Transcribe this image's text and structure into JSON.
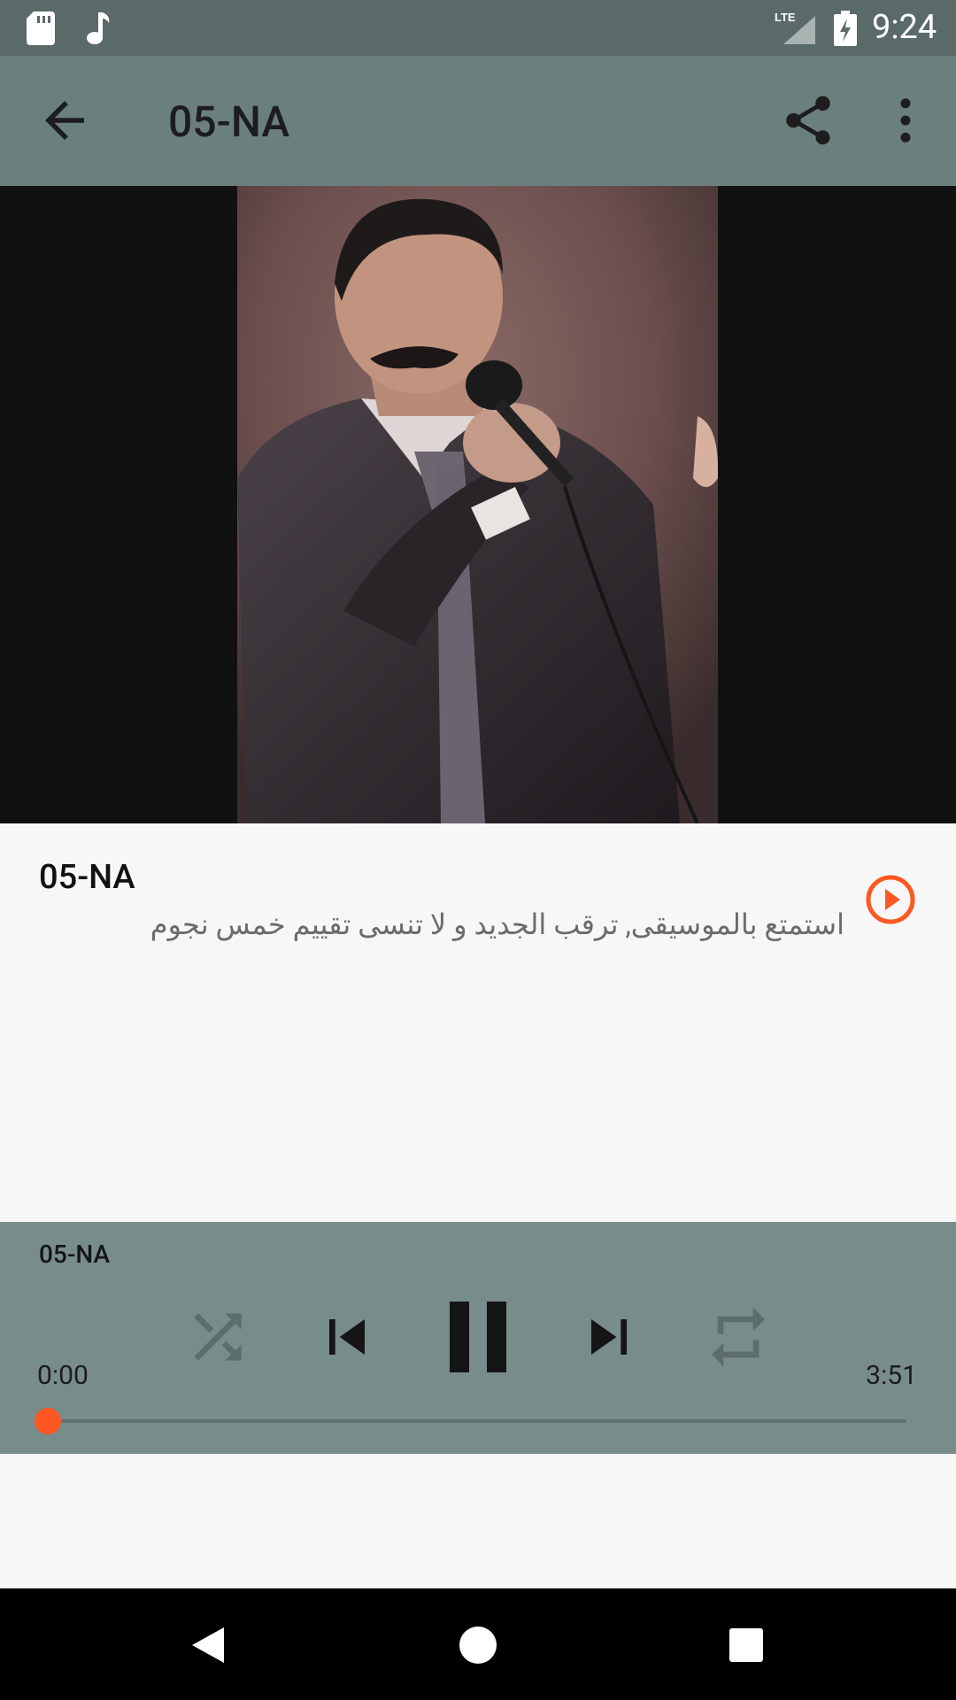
{
  "status_bar": {
    "time": "9:24",
    "network": "LTE",
    "icons": [
      "sd-card-icon",
      "music-note-icon",
      "lte-signal-icon",
      "battery-charging-icon"
    ]
  },
  "app_bar": {
    "title": "05-NA",
    "icons": [
      "arrow-back-icon",
      "share-icon",
      "more-vert-icon"
    ]
  },
  "artwork": {
    "description_icon": "album-artwork"
  },
  "track": {
    "title": "05-NA",
    "subtitle": "استمتع بالموسيقى, ترقب الجديد و لا تنسى تقييم خمس نجوم",
    "play_icon": "play-circle-icon"
  },
  "player": {
    "title": "05-NA",
    "current_time": "0:00",
    "total_time": "3:51",
    "progress": 0.0,
    "controls": [
      "shuffle-icon",
      "skip-previous-icon",
      "pause-icon",
      "skip-next-icon",
      "repeat-icon"
    ]
  },
  "nav_bar": {
    "icons": [
      "nav-back-icon",
      "nav-home-icon",
      "nav-recents-icon"
    ]
  },
  "colors": {
    "status_bar": "#5a6a69",
    "app_bar": "#6a7f7e",
    "player_panel": "#788c8b",
    "accent": "#ff5722",
    "background": "#f7f7f7"
  }
}
